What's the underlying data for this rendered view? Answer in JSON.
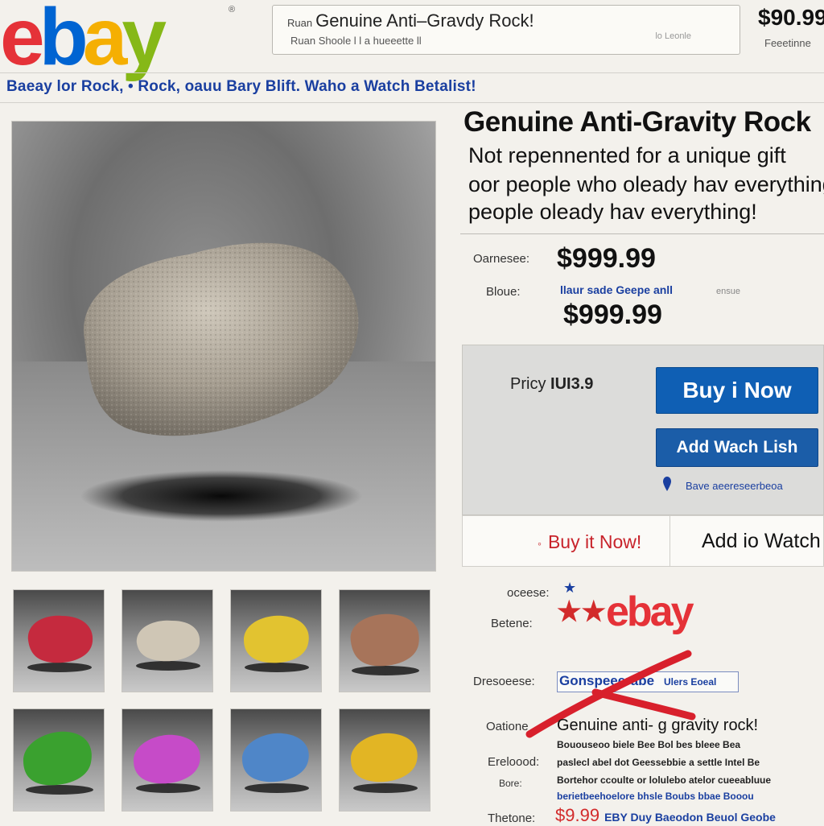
{
  "header": {
    "logo_letters": [
      "e",
      "b",
      "a",
      "y"
    ],
    "logo_tm": "®",
    "search_prefix": "Ruan",
    "search_query": "Genuine Anti–Gravdy Rock!",
    "search_sub": "Ruan Shoole l l a  hueeette ll",
    "search_location": "lo Leonle",
    "price": "$90.99",
    "price_sub": "Feeetinne"
  },
  "nav": {
    "text": "Baeay lor Rock, • Rock, oauu Bary Blift. Waho a Watch Betalist!"
  },
  "listing": {
    "title": "Genuine Anti-Gravity Rock",
    "desc_line1": "Not repennented for a unique gift",
    "desc_line2": "oor people who oleady hav everything",
    "desc_line3": "people oleady hav everything!",
    "price_label": "Oarnesee:",
    "price_main": "$999.99",
    "small_label": "Bloue:",
    "small_blue": "llaur sade Geepe anll",
    "small_grey": "ensue",
    "price_secondary": "$999.99"
  },
  "buybox": {
    "price_label": "Pricy",
    "price_value": "IUI3.9",
    "buy_now": "Buy i Now",
    "watch": "Add Wach Lish",
    "pin_text": "Bave aeereseerbeoa"
  },
  "strip": {
    "buy": "Buy it Now!",
    "watch": "Add io Watch"
  },
  "seller": {
    "labels": [
      "oceese:",
      "Betene:",
      "Dresoeese:",
      "Oatione",
      "Ereloood:",
      "Bore:",
      "Thetone:"
    ],
    "logo_text": "ebay",
    "boxed_text": "Gonspeeerabe",
    "boxed_right": "Ulers Eoeal",
    "small_title": "Genuine anti- g gravity rock!",
    "small_lines": [
      "Bououseoo biele Bee Bol bes bleee Bea",
      "paslecl abel dot Geessebbie a settle Intel Be",
      "Bortehor ccoulte or lolulebo atelor cueeabluue",
      "berietbeehoelore bhsle Boubs bbae Booou"
    ],
    "bottom_price": "$9.99",
    "bottom_text": "EBY Duy Baeodon Beuol Geobe"
  },
  "thumbnails": [
    {
      "name": "red-rock",
      "color": "#c52a3e"
    },
    {
      "name": "beige-rock",
      "color": "#cfc6b5"
    },
    {
      "name": "yellow-rock",
      "color": "#e2c330"
    },
    {
      "name": "brown-rock",
      "color": "#a7745a"
    },
    {
      "name": "green-rock",
      "color": "#3aa12f"
    },
    {
      "name": "purple-rock",
      "color": "#c64bc8"
    },
    {
      "name": "blue-rock",
      "color": "#4f86c8"
    },
    {
      "name": "gold-rock",
      "color": "#e2b524"
    }
  ],
  "colors": {
    "brand_red": "#e53238",
    "brand_blue": "#0064d2",
    "brand_yellow": "#f5af02",
    "brand_green": "#86b817",
    "button_blue": "#0f5fb4",
    "link_blue": "#1a3fa0"
  }
}
